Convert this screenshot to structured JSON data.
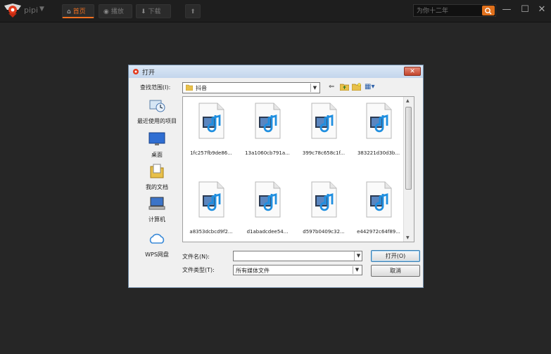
{
  "app": {
    "name": "pipi",
    "tabs": [
      {
        "label": "首页",
        "icon": "home-icon"
      },
      {
        "label": "播放",
        "icon": "play-icon"
      },
      {
        "label": "下载",
        "icon": "download-icon"
      }
    ],
    "search": {
      "placeholder": "为你十二年",
      "icon": "search-icon"
    },
    "window_controls": [
      "minimize-icon",
      "maximize-icon",
      "close-icon"
    ],
    "accent": "#f07020"
  },
  "dialog": {
    "title": "打开",
    "look_in_label": "查找范围(I):",
    "look_in_value": "抖音",
    "places": [
      {
        "label": "最近使用的项目",
        "icon": "recent-items-icon"
      },
      {
        "label": "桌面",
        "icon": "desktop-icon"
      },
      {
        "label": "我的文档",
        "icon": "documents-icon"
      },
      {
        "label": "计算机",
        "icon": "computer-icon"
      },
      {
        "label": "WPS网盘",
        "icon": "cloud-icon"
      }
    ],
    "files": [
      {
        "name": "1fc257fb9de86..."
      },
      {
        "name": "13a1060cb791a..."
      },
      {
        "name": "399c78c658c1f..."
      },
      {
        "name": "383221d30d3b..."
      },
      {
        "name": "a8353dcbcd9f2..."
      },
      {
        "name": "d1abadcdee54..."
      },
      {
        "name": "d597b0409c32..."
      },
      {
        "name": "e442972c64f89..."
      }
    ],
    "filename_label": "文件名(N):",
    "filename_value": "",
    "filetype_label": "文件类型(T):",
    "filetype_value": "所有媒体文件",
    "open_button": "打开(O)",
    "cancel_button": "取消"
  }
}
